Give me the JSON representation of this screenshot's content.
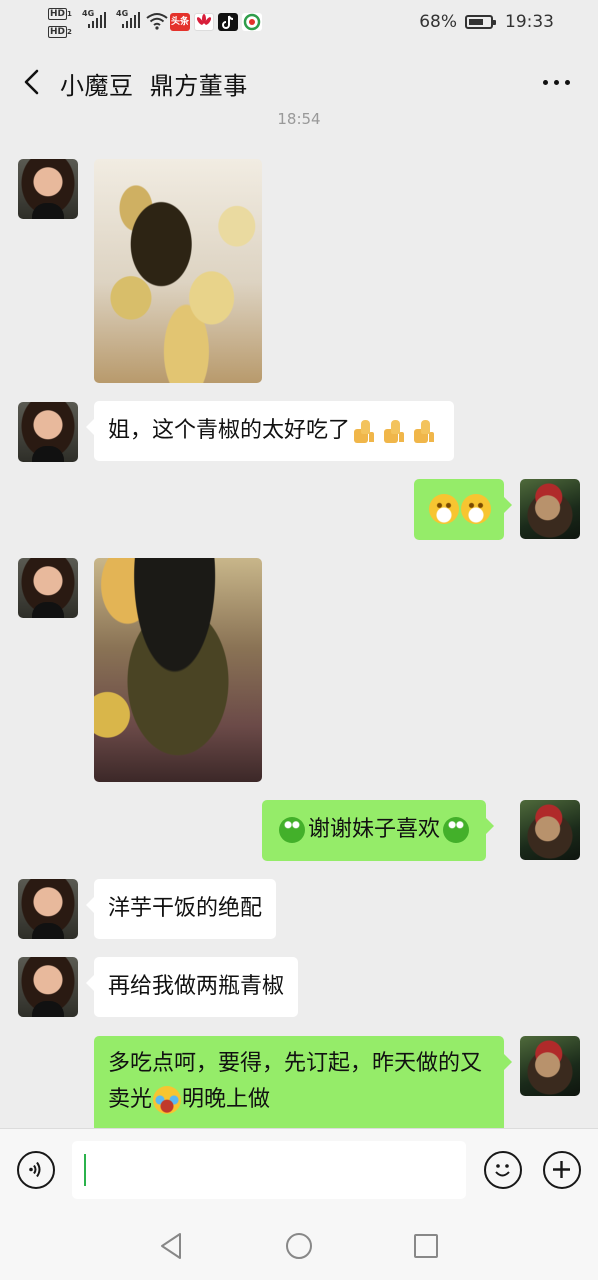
{
  "status_bar": {
    "hd1": "HD",
    "hd2": "HD",
    "net1": "4G",
    "net2": "4G",
    "apps": [
      {
        "name": "toutiao-icon",
        "label": "头条",
        "color": "#e4322b"
      },
      {
        "name": "huawei-icon",
        "color": "#d81e3a"
      },
      {
        "name": "tiktok-icon",
        "color": "#121212"
      },
      {
        "name": "browser-icon",
        "color": "#2f9d4a"
      }
    ],
    "battery_percent": "68%",
    "battery_level": 0.68,
    "time": "19:33"
  },
  "header": {
    "title": "小魔豆  鼎方董事"
  },
  "chat": {
    "timestamp": "18:54",
    "messages": [
      {
        "id": "m1",
        "side": "in",
        "type": "image",
        "alt": "土豆米饭配青椒酱"
      },
      {
        "id": "m2",
        "side": "in",
        "type": "text",
        "text": "姐，这个青椒的太好吃了",
        "emoji": [
          "thumbs-up",
          "thumbs-up",
          "thumbs-up"
        ]
      },
      {
        "id": "m3",
        "side": "out",
        "type": "emoji",
        "emoji": [
          "grin",
          "grin"
        ]
      },
      {
        "id": "m4",
        "side": "in",
        "type": "image",
        "alt": "一瓶青椒酱"
      },
      {
        "id": "m5",
        "side": "out",
        "type": "text",
        "text": "谢谢妹子喜欢"
      },
      {
        "id": "m6",
        "side": "in",
        "type": "text",
        "text": "洋芋干饭的绝配"
      },
      {
        "id": "m7",
        "side": "in",
        "type": "text",
        "text": "再给我做两瓶青椒"
      },
      {
        "id": "m8",
        "side": "out",
        "type": "text",
        "text_a": "多吃点呵，要得，先订起，昨天做的又卖光",
        "text_b": "明晚上做"
      }
    ]
  },
  "input": {
    "value": ""
  }
}
